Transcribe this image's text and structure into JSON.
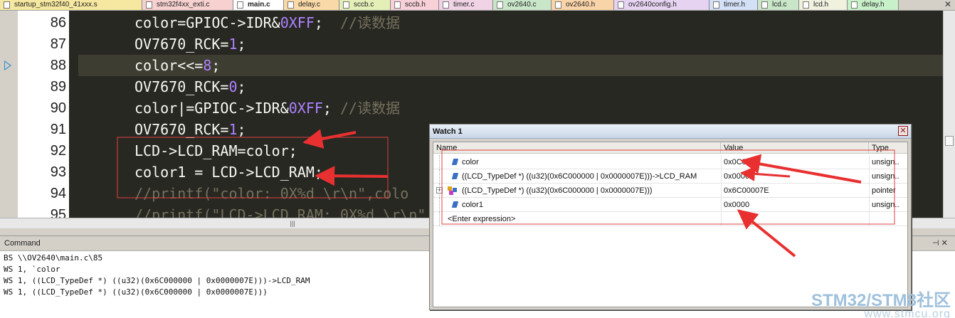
{
  "tabs": [
    {
      "label": "startup_stm32f40_41xxx.s",
      "color": "#f6e8a0",
      "w": 200
    },
    {
      "label": "stm32f4xx_exti.c",
      "color": "#f7d0d0",
      "w": 128
    },
    {
      "label": "main.c",
      "color": "#ffffff",
      "w": 71
    },
    {
      "label": "delay.c",
      "color": "#f9d9a8",
      "w": 78
    },
    {
      "label": "sccb.c",
      "color": "#e4efb8",
      "w": 72
    },
    {
      "label": "sccb.h",
      "color": "#f7d0d8",
      "w": 68
    },
    {
      "label": "timer.c",
      "color": "#f1d3e6",
      "w": 76
    },
    {
      "label": "ov2640.c",
      "color": "#c9e6c9",
      "w": 82
    },
    {
      "label": "ov2640.h",
      "color": "#f9d4a8",
      "w": 88
    },
    {
      "label": "ov2640config.h",
      "color": "#e6d3f1",
      "w": 134
    },
    {
      "label": "timer.h",
      "color": "#d3e0f6",
      "w": 68
    },
    {
      "label": "lcd.c",
      "color": "#c9e6c9",
      "w": 58
    },
    {
      "label": "lcd.h",
      "color": "#f1f1e0",
      "w": 68
    },
    {
      "label": "delay.h",
      "color": "#c9f1c9",
      "w": 72
    }
  ],
  "editor": {
    "lines": [
      {
        "num": "86",
        "parts": [
          [
            "t",
            "color=GPIOC->IDR&"
          ],
          [
            "n",
            "0XFF"
          ],
          [
            "t",
            ";  "
          ],
          [
            "c",
            "//读数据"
          ]
        ]
      },
      {
        "num": "87",
        "parts": [
          [
            "t",
            "OV7670_RCK="
          ],
          [
            "n",
            "1"
          ],
          [
            "t",
            ";"
          ]
        ]
      },
      {
        "num": "88",
        "parts": [
          [
            "t",
            "color<<="
          ],
          [
            "n",
            "8"
          ],
          [
            "t",
            ";"
          ]
        ],
        "current": true
      },
      {
        "num": "89",
        "parts": [
          [
            "t",
            "OV7670_RCK="
          ],
          [
            "n",
            "0"
          ],
          [
            "t",
            ";"
          ]
        ]
      },
      {
        "num": "90",
        "parts": [
          [
            "t",
            "color|=GPIOC->IDR&"
          ],
          [
            "n",
            "0XFF"
          ],
          [
            "t",
            "; "
          ],
          [
            "c",
            "//读数据"
          ]
        ]
      },
      {
        "num": "91",
        "parts": [
          [
            "t",
            "OV7670_RCK="
          ],
          [
            "n",
            "1"
          ],
          [
            "t",
            ";"
          ]
        ]
      },
      {
        "num": "92",
        "parts": [
          [
            "t",
            "LCD->LCD_RAM=color;"
          ]
        ]
      },
      {
        "num": "93",
        "parts": [
          [
            "t",
            "color1 = LCD->LCD_RAM;"
          ]
        ]
      },
      {
        "num": "94",
        "parts": [
          [
            "c",
            "//printf(\"color: 0X%d \\r\\n\",colo"
          ]
        ]
      },
      {
        "num": "95",
        "parts": [
          [
            "c",
            "//printf(\"LCD->LCD_RAM: 0X%d \\r\\n\""
          ]
        ]
      }
    ]
  },
  "command": {
    "title": "Command",
    "lines": [
      "BS \\\\OV2640\\main.c\\85",
      "WS 1, `color",
      "WS 1, ((LCD_TypeDef *) ((u32)(0x6C000000 | 0x0000007E)))->LCD_RAM",
      "WS 1, ((LCD_TypeDef *) ((u32)(0x6C000000 | 0x0000007E)))"
    ]
  },
  "watch": {
    "title": "Watch 1",
    "headers": {
      "name": "Name",
      "value": "Value",
      "type": "Type"
    },
    "rows": [
      {
        "name": "color",
        "value": "0x0C84",
        "type": "unsign..",
        "icon": "var"
      },
      {
        "name": "((LCD_TypeDef *) ((u32)(0x6C000000 | 0x0000007E)))->LCD_RAM",
        "value": "0x0000",
        "type": "unsign..",
        "icon": "var"
      },
      {
        "name": "((LCD_TypeDef *) ((u32)(0x6C000000 | 0x0000007E)))",
        "value": "0x6C00007E",
        "type": "pointer",
        "icon": "struct"
      },
      {
        "name": "color1",
        "value": "0x0000",
        "type": "unsign..",
        "icon": "var"
      },
      {
        "name": "<Enter expression>",
        "value": "",
        "type": "",
        "icon": "none"
      }
    ]
  },
  "watermark": {
    "line1": "STM32/STM8社区",
    "line2": "www.stmcu.org"
  },
  "colors": {
    "editor_bg": "#272822",
    "keyword_number": "#ae81ff",
    "comment": "#75715e",
    "annotation_red": "#e83030"
  }
}
